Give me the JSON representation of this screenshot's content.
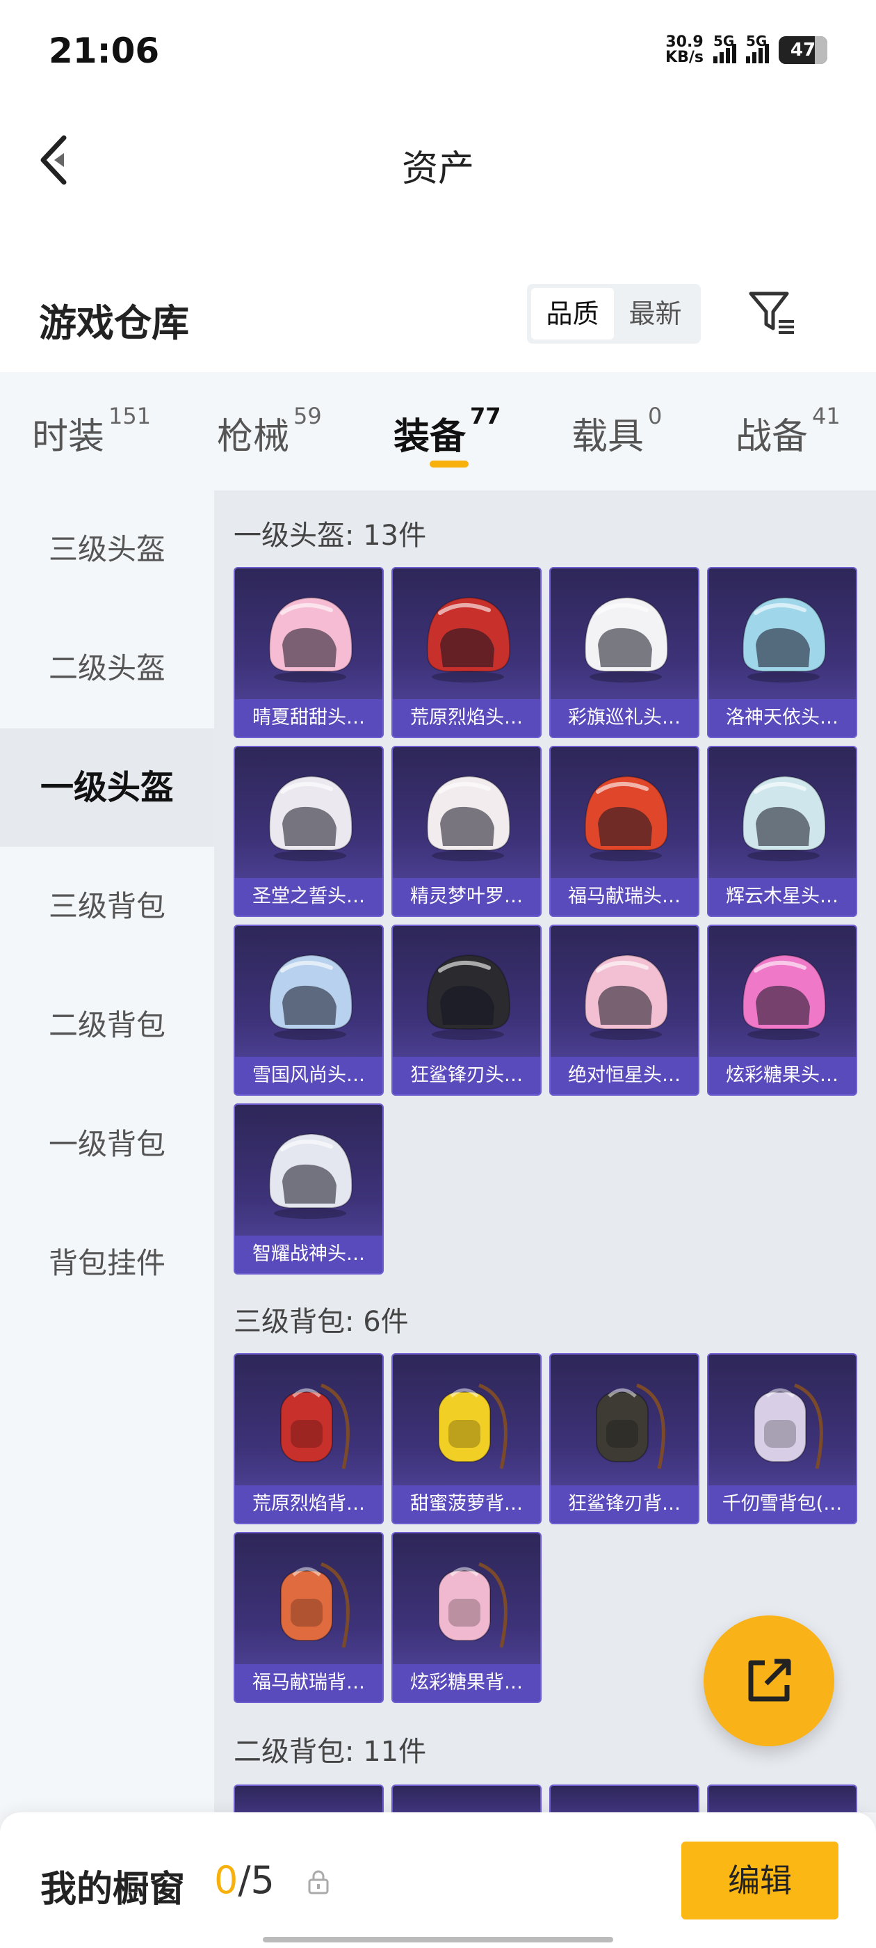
{
  "status_bar": {
    "time": "21:06",
    "net_speed": "30.9",
    "net_unit": "KB/s",
    "sim1": "5G",
    "sim2": "5G",
    "battery": "47"
  },
  "header": {
    "title": "资产"
  },
  "warehouse": {
    "title": "游戏仓库",
    "sort_options": [
      "品质",
      "最新"
    ],
    "sort_active": "品质"
  },
  "category_tabs": [
    {
      "label": "时装",
      "count": "151"
    },
    {
      "label": "枪械",
      "count": "59"
    },
    {
      "label": "装备",
      "count": "77"
    },
    {
      "label": "载具",
      "count": "0"
    },
    {
      "label": "战备",
      "count": "41"
    }
  ],
  "active_category": "装备",
  "sidebar": [
    "三级头盔",
    "二级头盔",
    "一级头盔",
    "三级背包",
    "二级背包",
    "一级背包",
    "背包挂件"
  ],
  "sidebar_active": "一级头盔",
  "sections": [
    {
      "title": "一级头盔: 13件",
      "items": [
        "晴夏甜甜头…",
        "荒原烈焰头…",
        "彩旗巡礼头…",
        "洛神天依头…",
        "圣堂之誓头…",
        "精灵梦叶罗…",
        "福马献瑞头…",
        "辉云木星头…",
        "雪国风尚头…",
        "狂鲨锋刃头…",
        "绝对恒星头…",
        "炫彩糖果头…",
        "智耀战神头…"
      ]
    },
    {
      "title": "三级背包: 6件",
      "items": [
        "荒原烈焰背…",
        "甜蜜菠萝背…",
        "狂鲨锋刃背…",
        "千仞雪背包(…",
        "福马献瑞背…",
        "炫彩糖果背…"
      ]
    },
    {
      "title": "二级背包: 11件",
      "items": []
    }
  ],
  "item_colors": {
    "helmets": [
      "#f6bcd3",
      "#c8302c",
      "#f3f3f5",
      "#9fd6ea",
      "#ece8f0",
      "#f2ecee",
      "#e0472a",
      "#cfe7ec",
      "#b7d1ee",
      "#2b2b2f",
      "#f2c0d2",
      "#f078c9",
      "#e4e6f0"
    ],
    "backpacks": [
      "#c8302c",
      "#f2cf24",
      "#3e3b35",
      "#d8cfe6",
      "#e06b3e",
      "#f0b9cf"
    ]
  },
  "bottom_bar": {
    "my_window": "我的橱窗",
    "current": "0",
    "total": "/5",
    "edit": "编辑"
  },
  "accent": "#f7b00c"
}
